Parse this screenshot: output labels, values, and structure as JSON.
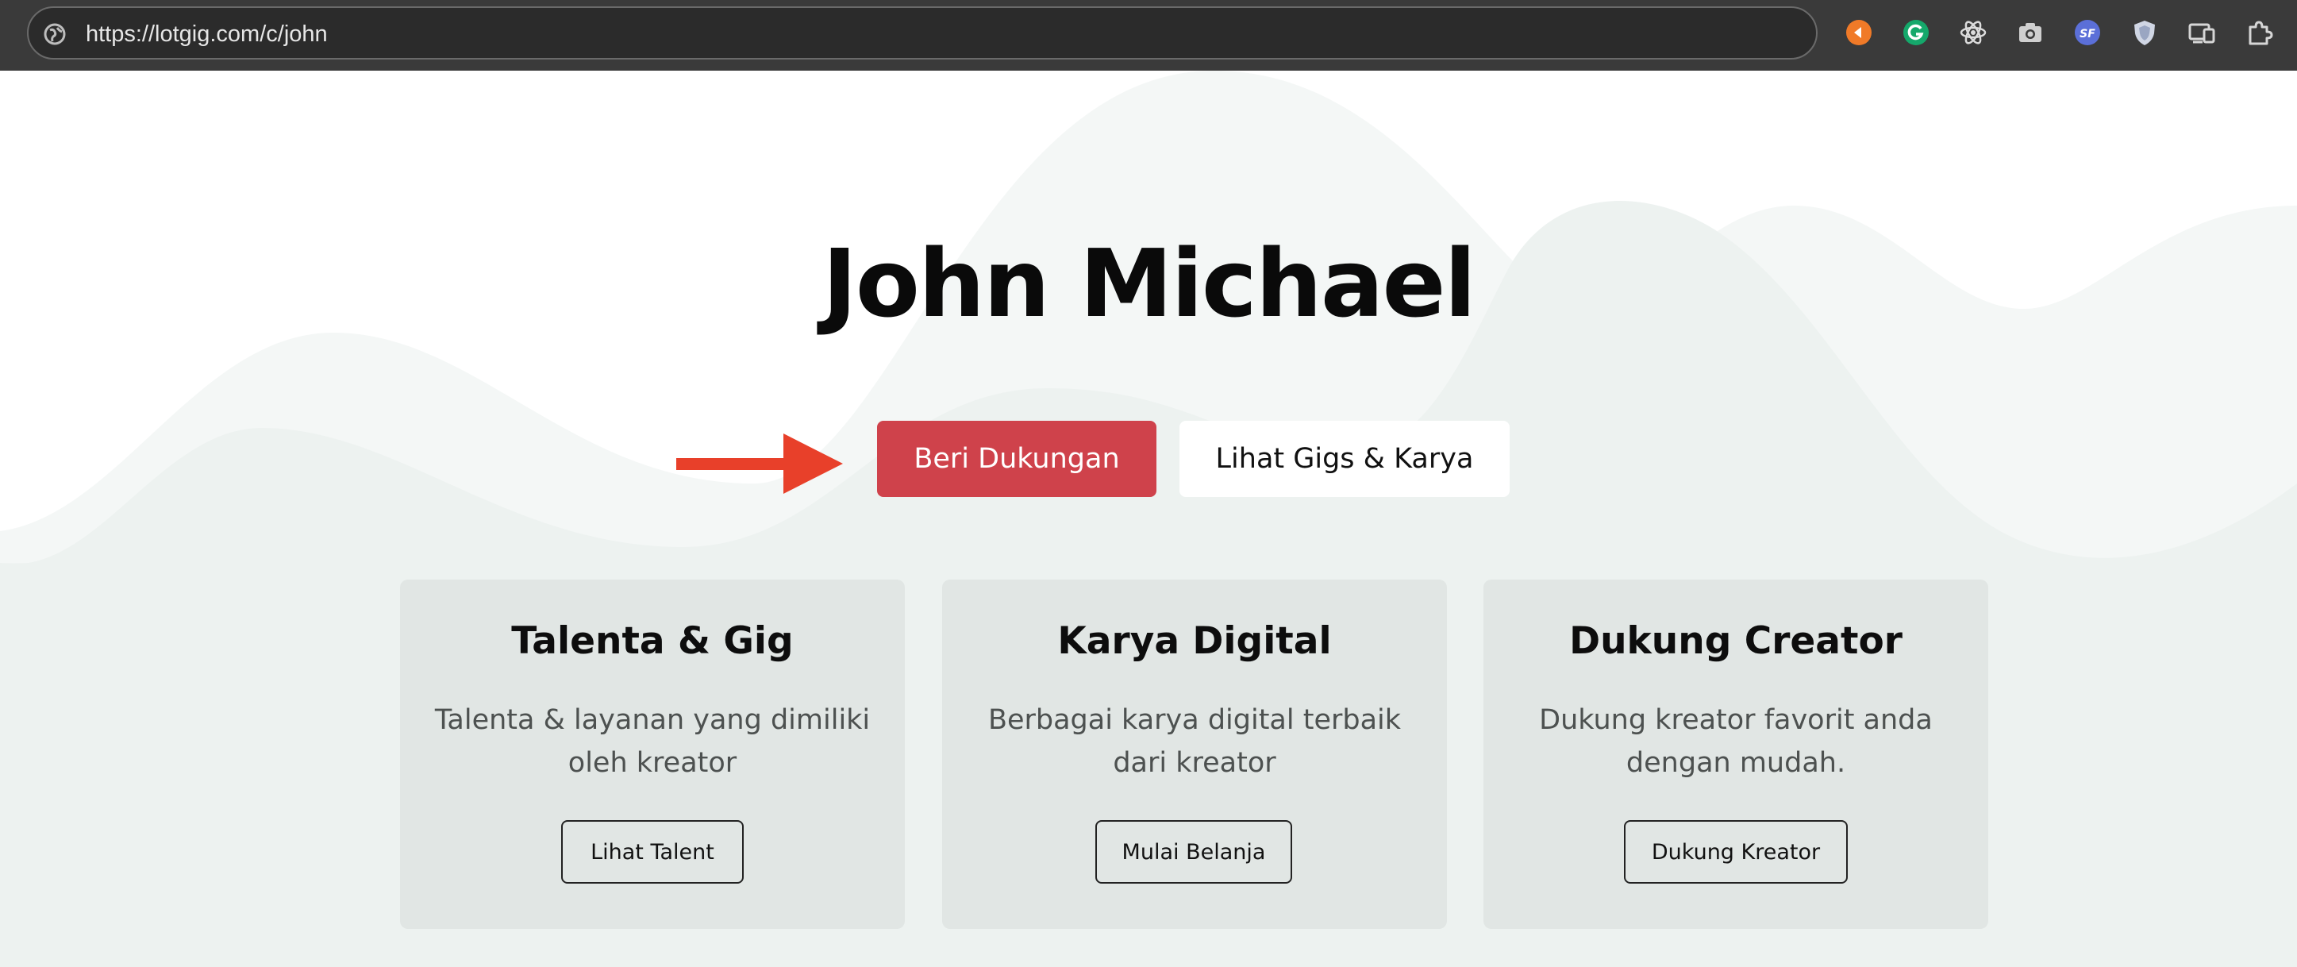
{
  "browser": {
    "url": "https://lotgig.com/c/john",
    "extensions": [
      "orange-extension-icon",
      "grammarly-icon",
      "react-devtools-icon",
      "camera-icon",
      "sf-extension-icon",
      "shield-extension-icon",
      "device-toolbar-icon",
      "extensions-puzzle-icon"
    ]
  },
  "hero": {
    "title": "John Michael",
    "support_button": "Beri Dukungan",
    "gigs_button": "Lihat Gigs & Karya"
  },
  "cards": [
    {
      "title": "Talenta & Gig",
      "description": "Talenta & layanan yang dimiliki oleh kreator",
      "button": "Lihat Talent"
    },
    {
      "title": "Karya Digital",
      "description": "Berbagai karya digital terbaik dari kreator",
      "button": "Mulai Belanja"
    },
    {
      "title": "Dukung Creator",
      "description": "Dukung kreator favorit anda dengan mudah.",
      "button": "Dukung Kreator"
    }
  ],
  "colors": {
    "accent": "#cf424b",
    "arrow": "#e8402a",
    "card_bg": "#e1e6e4",
    "page_bg": "#eef2f0"
  }
}
